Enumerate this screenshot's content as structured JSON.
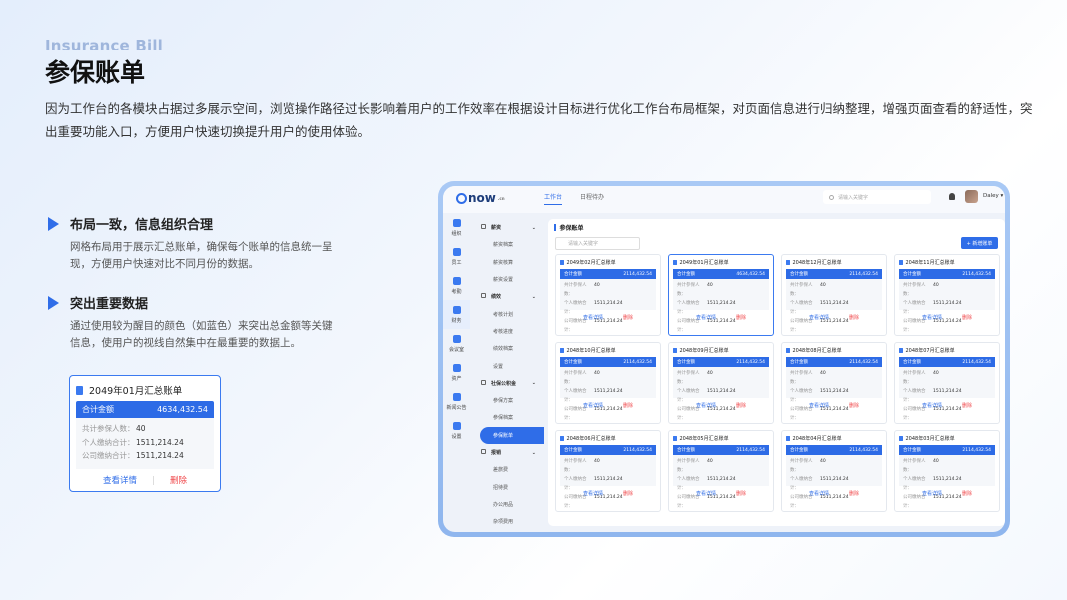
{
  "header": {
    "en_title": "Insurance Bill",
    "title": "参保账单",
    "intro": "因为工作台的各模块占据过多展示空间，浏览操作路径过长影响着用户的工作效率在根据设计目标进行优化工作台布局框架，对页面信息进行归纳整理，增强页面查看的舒适性，突出重要功能入口，方便用户快速切换提升用户的使用体验。"
  },
  "features": [
    {
      "title": "布局一致，信息组织合理",
      "desc": "网格布局用于展示汇总账单，确保每个账单的信息统一呈现，方便用户快速对比不同月份的数据。"
    },
    {
      "title": "突出重要数据",
      "desc": "通过使用较为醒目的颜色（如蓝色）来突出总金额等关键信息，使用户的视线自然集中在最重要的数据上。"
    }
  ],
  "highlight_card": {
    "title": "2049年01月汇总账单",
    "total_label": "合计金额",
    "total_value": "4634,432.54",
    "rows": [
      {
        "k": "共计参保人数：",
        "v": "40"
      },
      {
        "k": "个人缴纳合计：",
        "v": "1511,214.24"
      },
      {
        "k": "公司缴纳合计：",
        "v": "1511,214.24"
      }
    ],
    "view": "查看详情",
    "delete": "删除"
  },
  "app": {
    "logo": "now",
    "logo_small": ".cn",
    "tabs": [
      "工作台",
      "日程待办"
    ],
    "search_placeholder": "请输入关键字",
    "user": "Daley",
    "side_icons": [
      "组织",
      "员工",
      "考勤",
      "财务",
      "会议室",
      "资产",
      "新闻公告",
      "设置"
    ],
    "submenu": [
      {
        "label": "薪资",
        "group": true
      },
      {
        "label": "薪资档案"
      },
      {
        "label": "薪资核算"
      },
      {
        "label": "薪资设置"
      },
      {
        "label": "绩效",
        "group": true
      },
      {
        "label": "考核计划"
      },
      {
        "label": "考核进度"
      },
      {
        "label": "绩效档案"
      },
      {
        "label": "设置"
      },
      {
        "label": "社保公积金",
        "group": true
      },
      {
        "label": "参保方案"
      },
      {
        "label": "参保档案"
      },
      {
        "label": "参保账单",
        "active": true
      },
      {
        "label": "报销",
        "group": true
      },
      {
        "label": "差旅费"
      },
      {
        "label": "招待费"
      },
      {
        "label": "办公用品"
      },
      {
        "label": "杂项费用"
      }
    ],
    "content_title": "参保账单",
    "content_search": "请输入关键字",
    "new_button": "+ 新增账单",
    "card_labels": {
      "total": "合计金额",
      "k1": "共计参保人数：",
      "k2": "个人缴纳合计：",
      "k3": "公司缴纳合计：",
      "view": "查看详情",
      "delete": "删除"
    },
    "cards": [
      {
        "title": "2049年02月汇总账单",
        "total": "2114,432.54",
        "n": "40",
        "p": "1511,214.24",
        "c": "1511,214.24"
      },
      {
        "title": "2049年01月汇总账单",
        "total": "4634,432.54",
        "n": "40",
        "p": "1511,214.24",
        "c": "1511,214.24",
        "selected": true
      },
      {
        "title": "2048年12月汇总账单",
        "total": "2114,432.54",
        "n": "40",
        "p": "1511,214.24",
        "c": "1511,214.24"
      },
      {
        "title": "2048年11月汇总账单",
        "total": "2114,432.54",
        "n": "40",
        "p": "1511,214.24",
        "c": "1511,214.24"
      },
      {
        "title": "2048年10月汇总账单",
        "total": "2114,432.54",
        "n": "40",
        "p": "1511,214.24",
        "c": "1511,214.24"
      },
      {
        "title": "2048年09月汇总账单",
        "total": "2114,432.54",
        "n": "40",
        "p": "1511,214.24",
        "c": "1511,214.24"
      },
      {
        "title": "2048年08月汇总账单",
        "total": "2114,432.54",
        "n": "40",
        "p": "1511,214.24",
        "c": "1511,214.24"
      },
      {
        "title": "2048年07月汇总账单",
        "total": "2114,432.54",
        "n": "40",
        "p": "1511,214.24",
        "c": "1511,214.24"
      },
      {
        "title": "2048年06月汇总账单",
        "total": "2114,432.54",
        "n": "40",
        "p": "1511,214.24",
        "c": "1511,214.24"
      },
      {
        "title": "2048年05月汇总账单",
        "total": "2114,432.54",
        "n": "40",
        "p": "1511,214.24",
        "c": "1511,214.24"
      },
      {
        "title": "2048年04月汇总账单",
        "total": "2114,432.54",
        "n": "40",
        "p": "1511,214.24",
        "c": "1511,214.24"
      },
      {
        "title": "2048年03月汇总账单",
        "total": "2114,432.54",
        "n": "40",
        "p": "1511,214.24",
        "c": "1511,214.24"
      }
    ]
  },
  "colors": {
    "accent": "#2f6de8",
    "danger": "#f0484b"
  }
}
